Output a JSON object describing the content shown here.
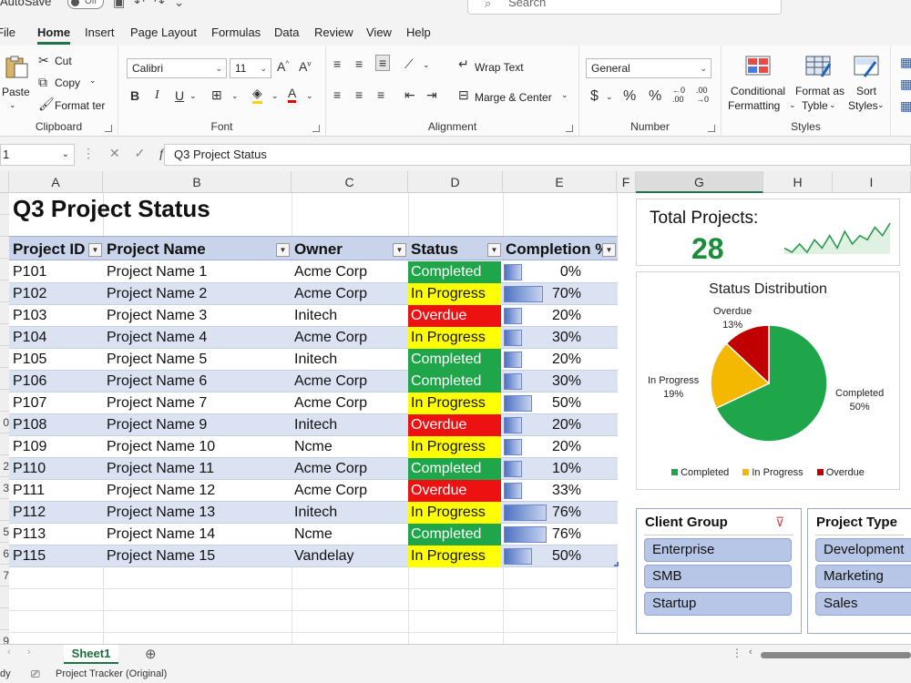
{
  "titlebar": {
    "autosave_label": "AutoSave",
    "autosave_state": "Off",
    "search_placeholder": "Search"
  },
  "tabs": [
    "File",
    "Home",
    "Insert",
    "Page Layout",
    "Formulas",
    "Data",
    "Review",
    "View",
    "Help"
  ],
  "active_tab": "Home",
  "ribbon": {
    "clipboard": {
      "label": "Clipboard",
      "paste": "Paste",
      "cut": "Cut",
      "copy": "Copy",
      "format_painter": "Format ter"
    },
    "font": {
      "label": "Font",
      "font_name": "Calibri",
      "font_size": "11",
      "bold": "B",
      "italic": "I",
      "underline": "U"
    },
    "alignment": {
      "label": "Alignment",
      "wrap_text": "Wrap Text",
      "merge_center": "Marge & Center"
    },
    "number": {
      "label": "Number",
      "format": "General",
      "currency": "$",
      "percent": "%",
      "comma": "%"
    },
    "styles": {
      "label": "Styles",
      "conditional": "Conditional",
      "conditional2": "Fermatting",
      "format_as": "Format as",
      "format_as2": "Tyble",
      "sort": "Sort",
      "sort2": "Styles"
    }
  },
  "formula_bar": {
    "name_box": "1",
    "fx": "fx",
    "content": "Q3 Project Status"
  },
  "columns": [
    "A",
    "B",
    "C",
    "D",
    "E",
    "F",
    "G",
    "H",
    "I"
  ],
  "selected_column": "G",
  "row_numbers_visible": [
    "",
    "",
    "",
    "",
    "",
    "",
    "",
    "",
    "",
    "",
    "0",
    "",
    "2",
    "3",
    "",
    "5",
    "6",
    "7",
    "",
    "",
    "9",
    ""
  ],
  "sheet": {
    "title": "Q3 Project Status",
    "headers": [
      "Project ID",
      "Project Name",
      "Owner",
      "Status",
      "Completion %"
    ],
    "rows": [
      {
        "id": "P101",
        "name": "Project Name 1",
        "owner": "Acme Corp",
        "status": "Completed",
        "pct": "0%",
        "value": 0
      },
      {
        "id": "P102",
        "name": "Project Name 2",
        "owner": "Acme Corp",
        "status": "In Progress",
        "pct": "70%",
        "value": 70
      },
      {
        "id": "P103",
        "name": "Project Name 3",
        "owner": "Initech",
        "status": "Overdue",
        "pct": "20%",
        "value": 20
      },
      {
        "id": "P104",
        "name": "Project Name 4",
        "owner": "Acme Corp",
        "status": "In Progress",
        "pct": "30%",
        "value": 30
      },
      {
        "id": "P105",
        "name": "Project Name 5",
        "owner": "Initech",
        "status": "Completed",
        "pct": "20%",
        "value": 20
      },
      {
        "id": "P106",
        "name": "Project Name 6",
        "owner": "Acme Corp",
        "status": "Completed",
        "pct": "30%",
        "value": 30
      },
      {
        "id": "P107",
        "name": "Project Name 7",
        "owner": "Acme Corp",
        "status": "In Progress",
        "pct": "50%",
        "value": 50
      },
      {
        "id": "P108",
        "name": "Project Name 9",
        "owner": "Initech",
        "status": "Overdue",
        "pct": "20%",
        "value": 20
      },
      {
        "id": "P109",
        "name": "Project Name 10",
        "owner": "Ncme",
        "status": "In Progress",
        "pct": "20%",
        "value": 20
      },
      {
        "id": "P110",
        "name": "Project Name 11",
        "owner": "Acme Corp",
        "status": "Completed",
        "pct": "10%",
        "value": 10
      },
      {
        "id": "P111",
        "name": "Project Name 12",
        "owner": "Acme Corp",
        "status": "Overdue",
        "pct": "33%",
        "value": 33
      },
      {
        "id": "P112",
        "name": "Project Name 13",
        "owner": "Initech",
        "status": "In Progress",
        "pct": "76%",
        "value": 76
      },
      {
        "id": "P113",
        "name": "Project Name 14",
        "owner": "Ncme",
        "status": "Completed",
        "pct": "76%",
        "value": 76
      },
      {
        "id": "P115",
        "name": "Project Name 15",
        "owner": "Vandelay",
        "status": "In Progress",
        "pct": "50%",
        "value": 50
      }
    ]
  },
  "kpi": {
    "title": "Total Projects:",
    "value": "28",
    "sparkline": [
      3,
      2,
      4,
      2,
      5,
      3,
      6,
      3,
      7,
      4,
      6,
      5,
      8,
      6,
      9
    ]
  },
  "pie": {
    "title": "Status Distribution",
    "slices": [
      {
        "name": "Completed",
        "label": "50%",
        "value": 68,
        "color": "#1fa64a"
      },
      {
        "name": "In Progress",
        "label": "19%",
        "value": 19,
        "color": "#f5b800"
      },
      {
        "name": "Overdue",
        "label": "13%",
        "value": 13,
        "color": "#c00000"
      }
    ]
  },
  "slicers": [
    {
      "title": "Client Group",
      "items": [
        "Enterprise",
        "SMB",
        "Startup"
      ]
    },
    {
      "title": "Project Type",
      "items": [
        "Development",
        "Marketing",
        "Sales"
      ]
    }
  ],
  "sheet_tabs": [
    "Sheet1"
  ],
  "statusbar": {
    "ready": "dy",
    "filename": "Project Tracker (Original)"
  },
  "colors": {
    "accent": "#217346",
    "completed": "#1fa64a",
    "in_progress": "#ffff00",
    "overdue": "#ee1111"
  }
}
